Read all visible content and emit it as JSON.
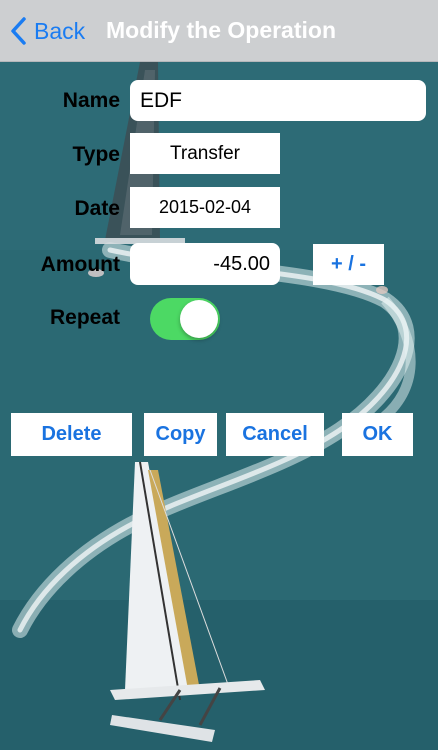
{
  "navbar": {
    "back_label": "Back",
    "title": "Modify the Operation"
  },
  "form": {
    "name_label": "Name",
    "name_value": "EDF",
    "type_label": "Type",
    "type_value": "Transfer",
    "date_label": "Date",
    "date_value": "2015-02-04",
    "amount_label": "Amount",
    "amount_value": "-45.00",
    "sign_button_label": "+ / -",
    "repeat_label": "Repeat",
    "repeat_on": true
  },
  "actions": {
    "delete_label": "Delete",
    "copy_label": "Copy",
    "cancel_label": "Cancel",
    "ok_label": "OK"
  },
  "colors": {
    "accent": "#1a73e0",
    "toggle_on": "#4cd964",
    "nav_bar": "#cdcfd1",
    "sea": "#2b6a73"
  },
  "icons": {
    "back": "chevron-left-icon"
  }
}
